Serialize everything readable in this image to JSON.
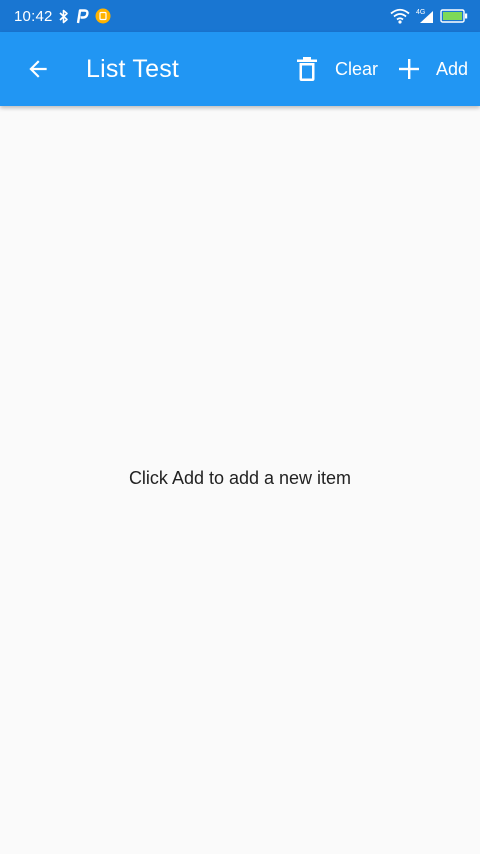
{
  "status_bar": {
    "time": "10:42",
    "network_label": "4G",
    "colors": {
      "background": "#1976d2",
      "notification_dot": "#ffb300"
    },
    "icons": [
      "bluetooth-icon",
      "p-app-icon",
      "notification-dot-icon",
      "wifi-icon",
      "signal-icon",
      "battery-icon"
    ]
  },
  "app_bar": {
    "title": "List Test",
    "back_icon": "arrow-back-icon",
    "colors": {
      "background": "#2196f3",
      "foreground": "#ffffff"
    },
    "actions": {
      "clear_label": "Clear",
      "clear_icon": "trash-icon",
      "add_label": "Add",
      "add_icon": "plus-icon"
    }
  },
  "content": {
    "empty_message": "Click Add to add a new item",
    "background": "#fafafa"
  }
}
